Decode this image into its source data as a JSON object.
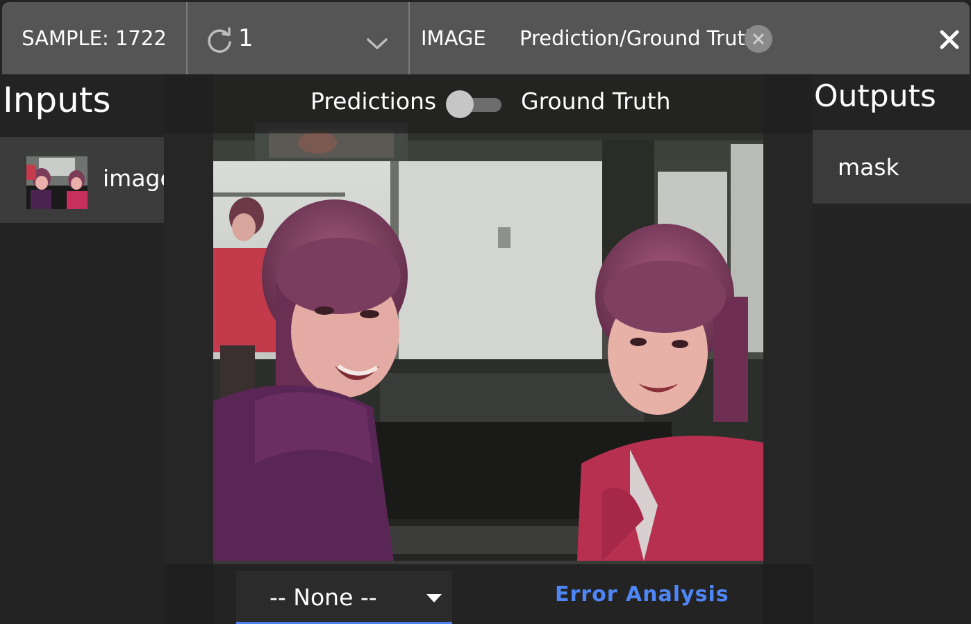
{
  "topbar": {
    "sample_label": "SAMPLE: 1722",
    "batch_value": "1",
    "field_label": "IMAGE",
    "mode_label": "Prediction/Ground Truth"
  },
  "inputs": {
    "title": "Inputs",
    "items": [
      {
        "label": "image"
      }
    ]
  },
  "outputs": {
    "title": "Outputs",
    "items": [
      {
        "label": "mask"
      }
    ]
  },
  "viewer": {
    "predictions_label": "Predictions",
    "ground_truth_label": "Ground Truth",
    "toggle_on": false
  },
  "bottom": {
    "filter_value": "-- None --",
    "error_analysis_label": "Error Analysis"
  },
  "colors": {
    "accent": "#4f86f7",
    "topbar": "#555555",
    "background": "#232323"
  },
  "icons": [
    "refresh-icon",
    "chevron-down-icon",
    "clear-icon",
    "close-icon",
    "caret-down-icon"
  ]
}
